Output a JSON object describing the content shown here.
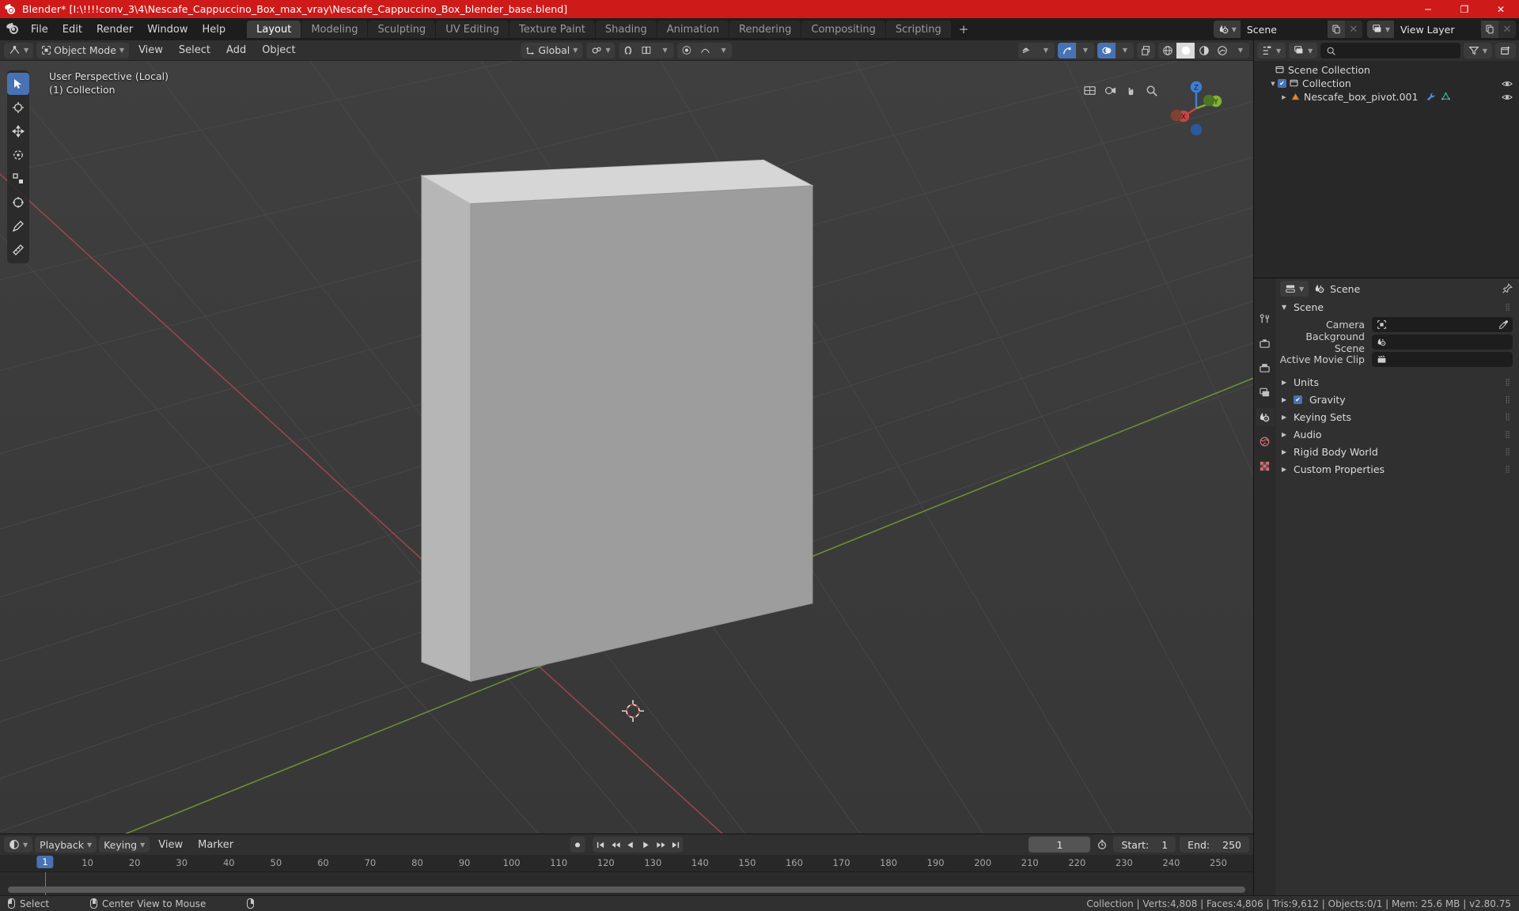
{
  "titlebar": {
    "text": "Blender* [I:\\!!!!conv_3\\4\\Nescafe_Cappuccino_Box_max_vray\\Nescafe_Cappuccino_Box_blender_base.blend]",
    "minimize": "─",
    "maximize": "❐",
    "close": "✕",
    "accent_color": "#cf1a1a"
  },
  "topbar": {
    "menus": [
      "File",
      "Edit",
      "Render",
      "Window",
      "Help"
    ],
    "workspaces": [
      {
        "label": "Layout",
        "active": true
      },
      {
        "label": "Modeling",
        "active": false
      },
      {
        "label": "Sculpting",
        "active": false
      },
      {
        "label": "UV Editing",
        "active": false
      },
      {
        "label": "Texture Paint",
        "active": false
      },
      {
        "label": "Shading",
        "active": false
      },
      {
        "label": "Animation",
        "active": false
      },
      {
        "label": "Rendering",
        "active": false
      },
      {
        "label": "Compositing",
        "active": false
      },
      {
        "label": "Scripting",
        "active": false
      }
    ],
    "add_workspace": "+",
    "scene_name": "Scene",
    "view_layer_name": "View Layer",
    "new_copy_icon": "copy-icon",
    "unlink_icon": "x-icon"
  },
  "viewport_header": {
    "editor_type_icon": "editor-type-icon",
    "mode": "Object Mode",
    "menus": [
      "View",
      "Select",
      "Add",
      "Object"
    ],
    "transform_orientation": "Global",
    "snap_icon": "magnet-icon",
    "proportional_icon": "proportional-edit-icon",
    "visibility_icon": "eye-icon",
    "gizmo_icon": "gizmo-icon",
    "overlays_icon": "overlays-icon",
    "xray_icon": "xray-icon",
    "shading_modes": [
      "wireframe",
      "solid",
      "material-preview",
      "rendered"
    ],
    "active_shading": "solid"
  },
  "viewport": {
    "overlay_line1": "User Perspective (Local)",
    "overlay_line2": "(1) Collection",
    "gizmo_axes": [
      "X",
      "Y",
      "Z"
    ],
    "tools": [
      {
        "name": "tweak-tool",
        "active": true
      },
      {
        "name": "cursor-tool",
        "active": false
      },
      {
        "name": "move-tool",
        "active": false
      },
      {
        "name": "rotate-tool",
        "active": false
      },
      {
        "name": "scale-tool",
        "active": false
      },
      {
        "name": "transform-tool",
        "active": false
      },
      {
        "name": "annotate-tool",
        "active": false
      },
      {
        "name": "measure-tool",
        "active": false
      }
    ],
    "object_label": "Nescafe_box_pivot.001"
  },
  "timeline": {
    "editor_icon": "timeline-editor-icon",
    "menus": [
      "Playback",
      "Keying",
      "View",
      "Marker"
    ],
    "record_icon": "record-icon",
    "jump_start_icon": "jump-to-start-icon",
    "prev_keyframe_icon": "prev-keyframe-icon",
    "play_reverse_icon": "play-reverse-icon",
    "play_icon": "play-icon",
    "next_keyframe_icon": "next-keyframe-icon",
    "jump_end_icon": "jump-to-end-icon",
    "current_frame": "1",
    "auto_key_icon": "auto-keying-icon",
    "start_label": "Start:",
    "start_value": "1",
    "end_label": "End:",
    "end_value": "250",
    "ticks": [
      "1",
      "10",
      "20",
      "30",
      "40",
      "50",
      "60",
      "70",
      "80",
      "90",
      "100",
      "110",
      "120",
      "130",
      "140",
      "150",
      "160",
      "170",
      "180",
      "190",
      "200",
      "210",
      "220",
      "230",
      "240",
      "250"
    ],
    "playhead_frame": "1"
  },
  "outliner": {
    "display_mode_icon": "outliner-display-mode-icon",
    "view_layer_icon": "view-layer-icon",
    "search_placeholder": "",
    "filter_icon": "filter-icon",
    "new_collection_icon": "new-collection-icon",
    "rows": [
      {
        "label": "Scene Collection",
        "icon": "collection-icon",
        "indent": 0,
        "has_disclosure": false,
        "has_checkbox": false,
        "has_eye": false
      },
      {
        "label": "Collection",
        "icon": "collection-icon",
        "indent": 1,
        "has_disclosure": true,
        "has_checkbox": true,
        "has_eye": true
      },
      {
        "label": "Nescafe_box_pivot.001",
        "icon": "empty-object-icon",
        "indent": 2,
        "has_disclosure": true,
        "has_checkbox": false,
        "has_eye": true,
        "extra_icons": [
          "wrench-icon",
          "mesh-data-icon"
        ]
      }
    ]
  },
  "properties": {
    "editor_icon": "properties-editor-icon",
    "breadcrumb_icon": "scene-icon",
    "breadcrumb": "Scene",
    "pin_icon": "pin-icon",
    "tabs": [
      {
        "name": "tool-tab",
        "icon": "tool-icon",
        "active": false
      },
      {
        "name": "render-tab",
        "icon": "render-icon",
        "active": false
      },
      {
        "name": "output-tab",
        "icon": "output-icon",
        "active": false
      },
      {
        "name": "view-layer-tab",
        "icon": "view-layer-icon",
        "active": false
      },
      {
        "name": "scene-tab",
        "icon": "scene-icon",
        "active": true
      },
      {
        "name": "world-tab",
        "icon": "world-icon",
        "active": false
      },
      {
        "name": "texture-tab",
        "icon": "texture-icon",
        "active": false
      }
    ],
    "panel_title": "Scene",
    "fields": [
      {
        "label": "Camera",
        "icon": "camera-icon",
        "value": "",
        "has_eyedropper": true
      },
      {
        "label": "Background Scene",
        "icon": "scene-icon",
        "value": "",
        "has_eyedropper": false
      },
      {
        "label": "Active Movie Clip",
        "icon": "movie-clip-icon",
        "value": "",
        "has_eyedropper": false
      }
    ],
    "sections": [
      {
        "label": "Units",
        "checkbox": null
      },
      {
        "label": "Gravity",
        "checkbox": true
      },
      {
        "label": "Keying Sets",
        "checkbox": null
      },
      {
        "label": "Audio",
        "checkbox": null
      },
      {
        "label": "Rigid Body World",
        "checkbox": null
      },
      {
        "label": "Custom Properties",
        "checkbox": null
      }
    ]
  },
  "statusbar": {
    "hints": [
      {
        "mouse": "left",
        "label": "Select"
      },
      {
        "mouse": "middle",
        "label": "Center View to Mouse"
      },
      {
        "mouse": "right",
        "label": ""
      }
    ],
    "stats": "Collection | Verts:4,808 | Faces:4,806 | Tris:9,612 | Objects:0/1 | Mem: 25.6 MB | v2.80.75"
  }
}
